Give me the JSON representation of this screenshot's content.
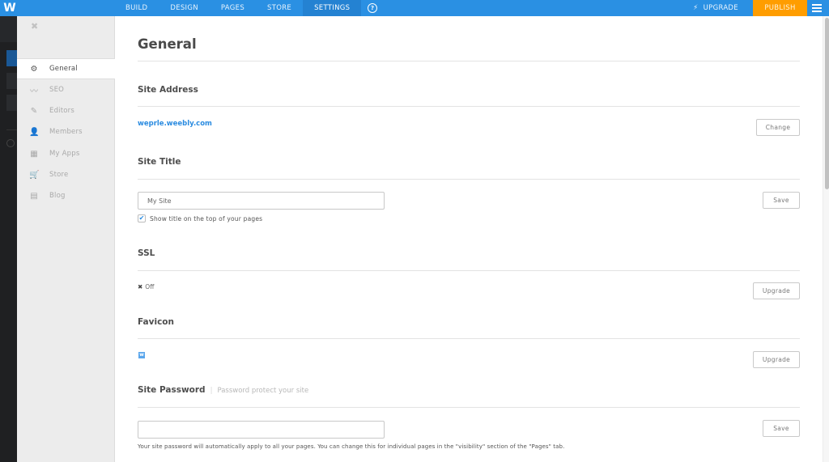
{
  "topbar": {
    "logo": "W",
    "nav": [
      {
        "label": "BUILD",
        "active": false
      },
      {
        "label": "DESIGN",
        "active": false
      },
      {
        "label": "PAGES",
        "active": false
      },
      {
        "label": "STORE",
        "active": false
      },
      {
        "label": "SETTINGS",
        "active": true
      }
    ],
    "help_icon": "?",
    "upgrade_icon": "⚡",
    "upgrade_label": "UPGRADE",
    "publish_label": "PUBLISH",
    "colors": {
      "bar": "#2a90e3",
      "publish": "#ff9d00"
    }
  },
  "sidebar": {
    "close_icon": "✖",
    "items": [
      {
        "label": "General",
        "icon": "⚙",
        "active": true
      },
      {
        "label": "SEO",
        "icon": "〰",
        "active": false
      },
      {
        "label": "Editors",
        "icon": "✎",
        "active": false
      },
      {
        "label": "Members",
        "icon": "👤",
        "active": false
      },
      {
        "label": "My Apps",
        "icon": "▦",
        "active": false
      },
      {
        "label": "Store",
        "icon": "🛒",
        "active": false
      },
      {
        "label": "Blog",
        "icon": "▤",
        "active": false
      }
    ]
  },
  "main": {
    "title": "General",
    "site_address": {
      "title": "Site Address",
      "url": "weprle.weebly.com",
      "button": "Change"
    },
    "site_title": {
      "title": "Site Title",
      "value": "My Site",
      "show_title_checked": true,
      "checkbox_label": "Show title on the top of your pages",
      "button": "Save"
    },
    "ssl": {
      "title": "SSL",
      "status_icon": "✖",
      "status": "Off",
      "button": "Upgrade"
    },
    "favicon": {
      "title": "Favicon",
      "icon": "w",
      "button": "Upgrade"
    },
    "site_password": {
      "title": "Site Password",
      "subtitle": "Password protect your site",
      "value": "",
      "button": "Save",
      "help": "Your site password will automatically apply to all your pages. You can change this for individual pages in the \"visibility\" section of the \"Pages\" tab."
    }
  }
}
